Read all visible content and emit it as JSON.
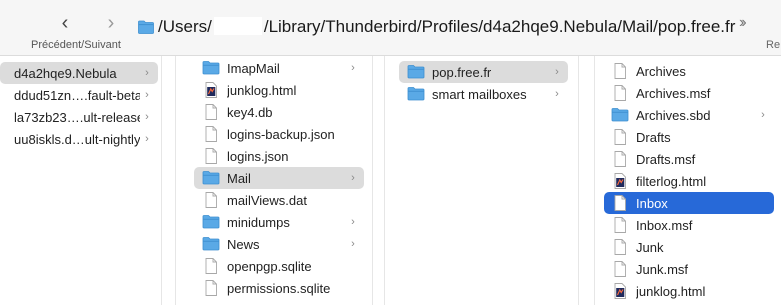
{
  "toolbar": {
    "nav_label": "Précédent/Suivant",
    "path_prefix": "/Users/",
    "path_suffix": "/Library/Thunderbird/Profiles/d4a2hqe9.Nebula/Mail/pop.free.fr",
    "next_label": "Re",
    "back_icon": "chevron-left-icon",
    "forward_icon": "chevron-right-icon",
    "more_icon": "double-chevron-right-icon"
  },
  "colors": {
    "selection_active": "#2769d8",
    "selection_inactive": "#dcdcdc",
    "folder": "#5aa9e6"
  },
  "columns": [
    {
      "items": [
        {
          "label": "d4a2hqe9.Nebula",
          "chevron": true,
          "selected": "grey"
        },
        {
          "label": "ddud51zn….fault-beta",
          "chevron": true
        },
        {
          "label": "la73zb23….ult-release",
          "chevron": true
        },
        {
          "label": "uu8iskls.d…ult-nightly",
          "chevron": true
        }
      ]
    },
    {
      "items": [
        {
          "label": "ImapMail",
          "icon": "folder",
          "chevron": true
        },
        {
          "label": "junklog.html",
          "icon": "html"
        },
        {
          "label": "key4.db",
          "icon": "doc"
        },
        {
          "label": "logins-backup.json",
          "icon": "doc"
        },
        {
          "label": "logins.json",
          "icon": "doc"
        },
        {
          "label": "Mail",
          "icon": "folder",
          "chevron": true,
          "selected": "grey"
        },
        {
          "label": "mailViews.dat",
          "icon": "doc"
        },
        {
          "label": "minidumps",
          "icon": "folder",
          "chevron": true
        },
        {
          "label": "News",
          "icon": "folder",
          "chevron": true
        },
        {
          "label": "openpgp.sqlite",
          "icon": "doc"
        },
        {
          "label": "permissions.sqlite",
          "icon": "doc"
        }
      ]
    },
    {
      "items": [
        {
          "label": "pop.free.fr",
          "icon": "folder",
          "chevron": true,
          "selected": "grey"
        },
        {
          "label": "smart mailboxes",
          "icon": "folder",
          "chevron": true
        }
      ]
    },
    {
      "items": [
        {
          "label": "Archives",
          "icon": "doc"
        },
        {
          "label": "Archives.msf",
          "icon": "doc"
        },
        {
          "label": "Archives.sbd",
          "icon": "folder",
          "chevron": true
        },
        {
          "label": "Drafts",
          "icon": "doc"
        },
        {
          "label": "Drafts.msf",
          "icon": "doc"
        },
        {
          "label": "filterlog.html",
          "icon": "html"
        },
        {
          "label": "Inbox",
          "icon": "doc",
          "selected": "blue"
        },
        {
          "label": "Inbox.msf",
          "icon": "doc"
        },
        {
          "label": "Junk",
          "icon": "doc"
        },
        {
          "label": "Junk.msf",
          "icon": "doc"
        },
        {
          "label": "junklog.html",
          "icon": "html"
        }
      ]
    }
  ]
}
